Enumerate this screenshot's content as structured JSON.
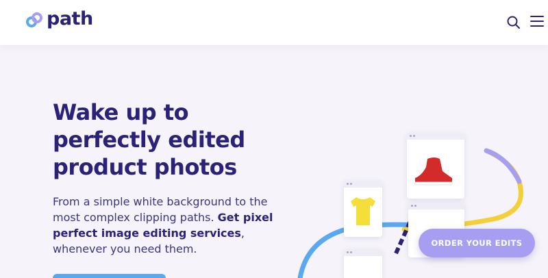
{
  "header": {
    "logo_text": "path",
    "search_icon": "search-icon",
    "menu_icon": "hamburger-menu-icon"
  },
  "hero": {
    "title": "Wake up to perfectly edited product photos",
    "text_plain": "From a simple white background to the most complex clipping paths. ",
    "text_bold": "Get pixel perfect image editing services",
    "text_end": ", whenever you need them."
  },
  "cta": {
    "order_label": "ORDER YOUR EDITS"
  },
  "colors": {
    "brand": "#2a2178",
    "accent_blue": "#5aa8ef",
    "accent_purple": "#a79ef2",
    "accent_yellow": "#f4cf3a",
    "background": "#f6f4fa"
  }
}
